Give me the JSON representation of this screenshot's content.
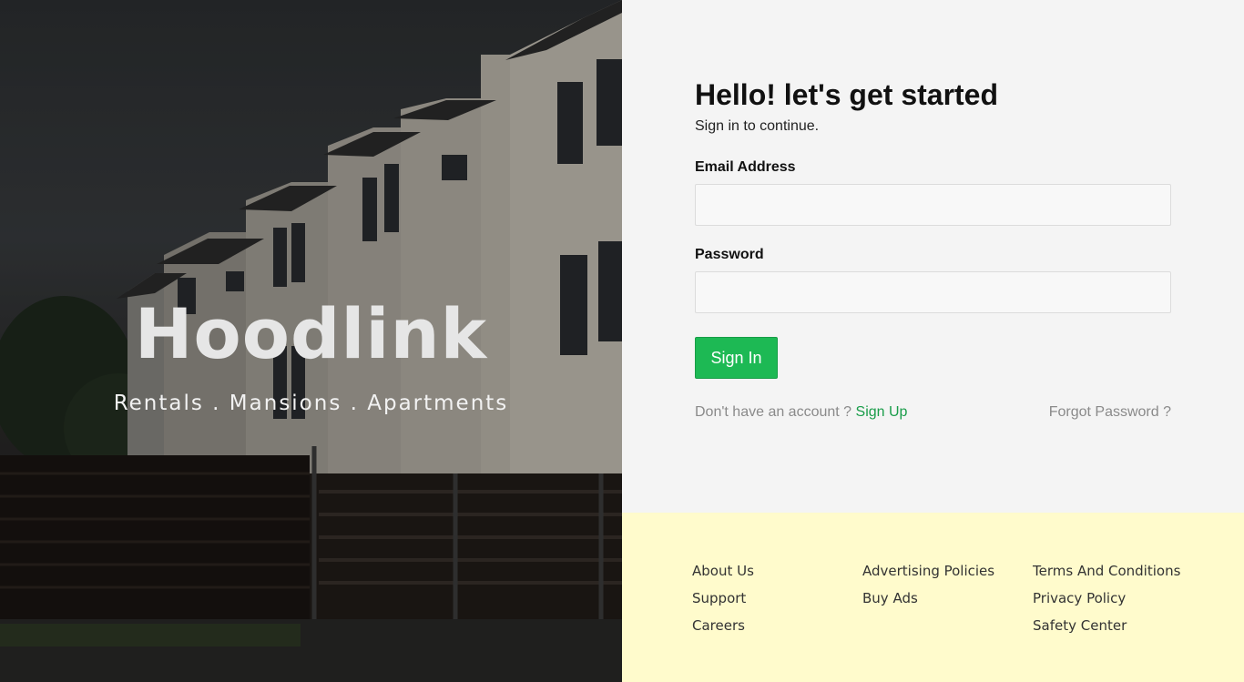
{
  "hero": {
    "brand": "Hoodlink",
    "tagline": "Rentals . Mansions . Apartments"
  },
  "login": {
    "title": "Hello! let's get started",
    "subtitle": "Sign in to continue.",
    "email_label": "Email Address",
    "email_value": "",
    "password_label": "Password",
    "password_value": "",
    "signin_label": "Sign In",
    "no_account_text": "Don't have an account ? ",
    "signup_label": "Sign Up",
    "forgot_label": "Forgot Password ?"
  },
  "footer": {
    "col1": [
      "About Us",
      "Support",
      "Careers"
    ],
    "col2": [
      "Advertising Policies",
      "Buy Ads"
    ],
    "col3": [
      "Terms And Conditions",
      "Privacy Policy",
      "Safety Center"
    ]
  },
  "colors": {
    "accent": "#1db954",
    "footer_bg": "#fffbcc",
    "panel_bg": "#f4f4f4"
  }
}
